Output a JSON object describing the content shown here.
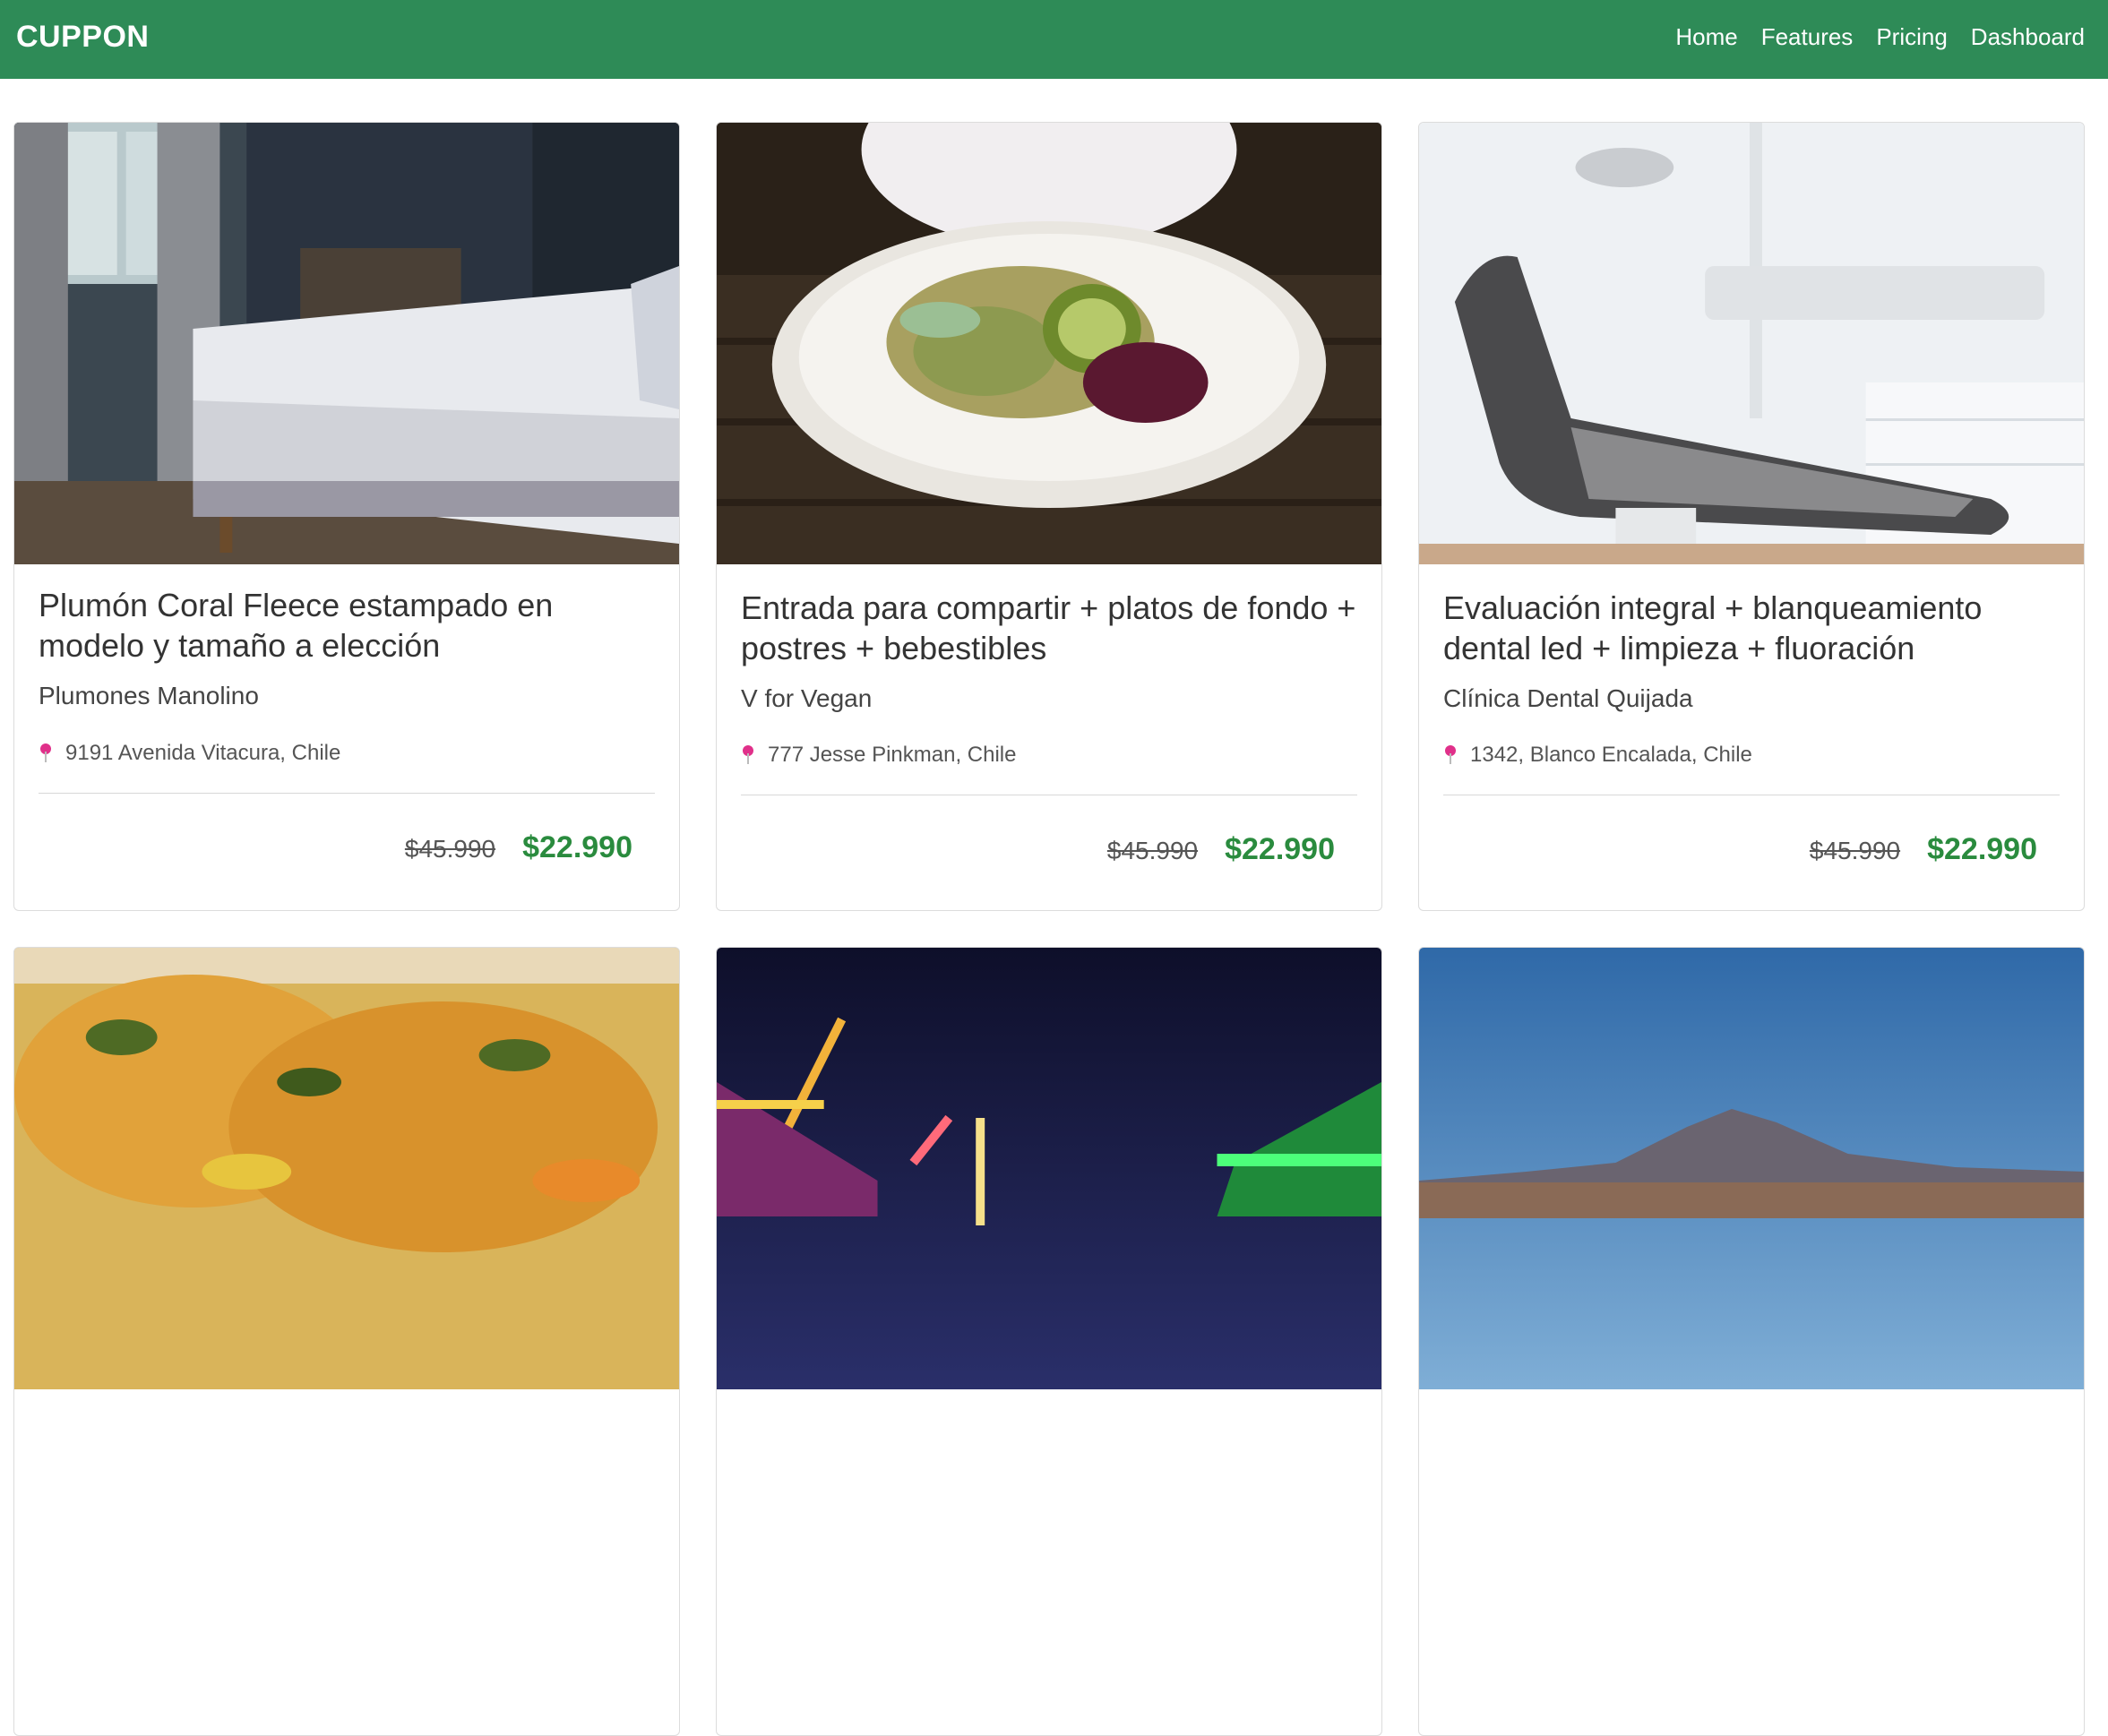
{
  "nav": {
    "brand": "CUPPON",
    "links": [
      "Home",
      "Features",
      "Pricing",
      "Dashboard"
    ]
  },
  "colors": {
    "navbar": "#2e8b57",
    "price": "#2a8b3e",
    "pin": "#e0308a"
  },
  "cards": [
    {
      "title": "Plumón Coral Fleece estampado en modelo y tamaño a elección",
      "vendor": "Plumones Manolino",
      "location": "9191 Avenida Vitacura, Chile",
      "old_price": "$45.990",
      "new_price": "$22.990",
      "image": "bedroom-photo"
    },
    {
      "title": "Entrada para compartir + platos de fondo + postres + bebestibles",
      "vendor": "V for Vegan",
      "location": "777 Jesse Pinkman, Chile",
      "old_price": "$45.990",
      "new_price": "$22.990",
      "image": "vegan-salad-photo"
    },
    {
      "title": "Evaluación integral + blanqueamiento dental led + limpieza + fluoración",
      "vendor": "Clínica Dental Quijada",
      "location": "1342, Blanco Encalada, Chile",
      "old_price": "$45.990",
      "new_price": "$22.990",
      "image": "dental-chair-photo"
    },
    {
      "image": "food-dish-photo"
    },
    {
      "image": "carnival-night-photo"
    },
    {
      "image": "desert-mountain-photo"
    }
  ]
}
